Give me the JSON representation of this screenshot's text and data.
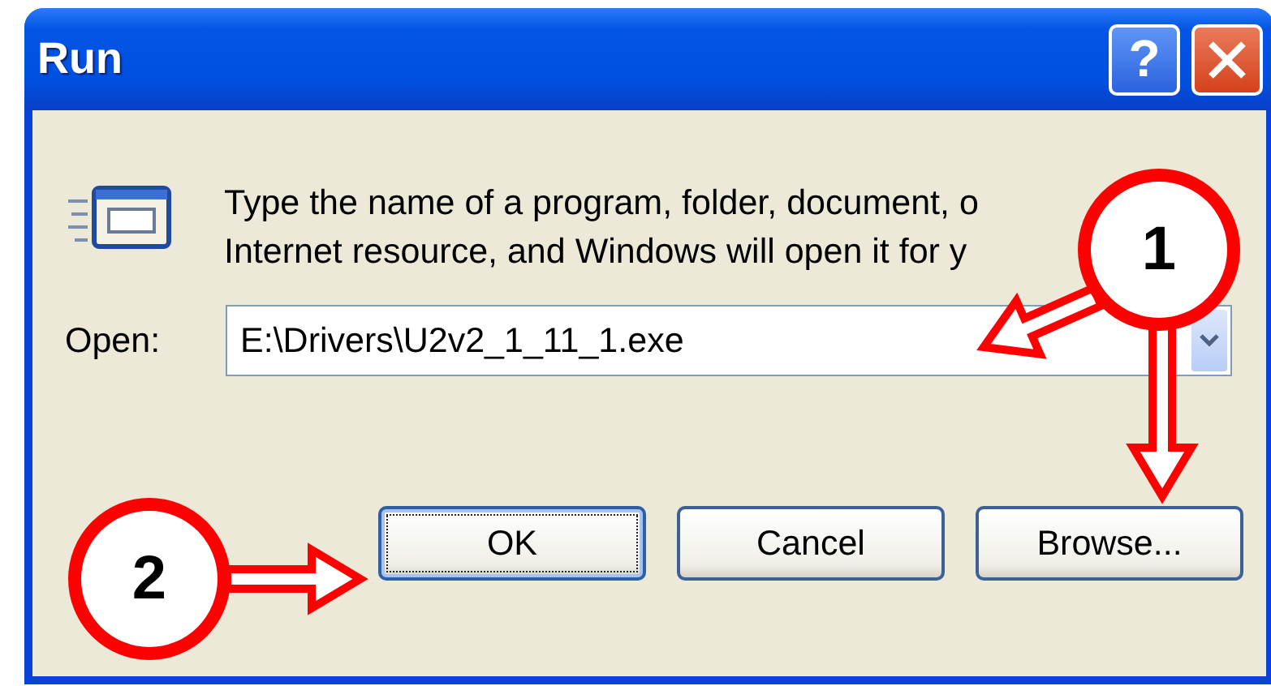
{
  "window": {
    "title": "Run"
  },
  "title_buttons": [
    {
      "kind": "help",
      "label": "?"
    },
    {
      "kind": "close"
    }
  ],
  "prompt": [
    "Type the name of a program, folder, document, o",
    "Internet resource, and Windows will open it for y"
  ],
  "open_field": {
    "label": "Open:",
    "value": "E:\\Drivers\\U2v2_1_11_1.exe"
  },
  "buttons": [
    {
      "label": "OK",
      "selected": true
    },
    {
      "label": "Cancel",
      "selected": false
    },
    {
      "label": "Browse...",
      "selected": false
    }
  ],
  "annotations": [
    {
      "label": "1"
    },
    {
      "label": "2"
    }
  ]
}
